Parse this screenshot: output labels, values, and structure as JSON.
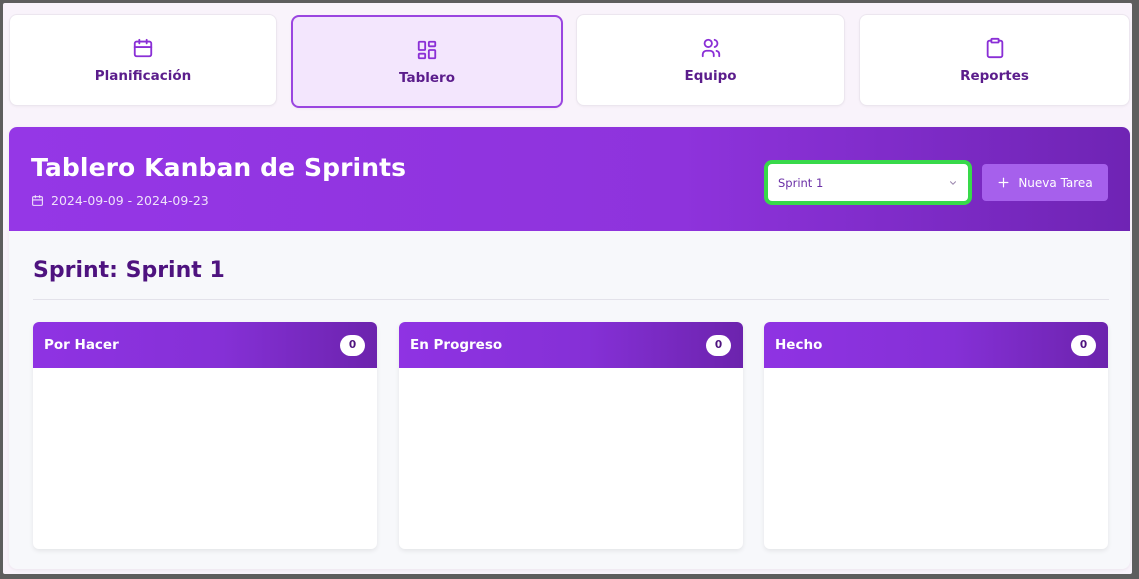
{
  "nav": {
    "items": [
      {
        "label": "Planificación",
        "icon": "calendar-icon",
        "active": false
      },
      {
        "label": "Tablero",
        "icon": "board-icon",
        "active": true
      },
      {
        "label": "Equipo",
        "icon": "users-icon",
        "active": false
      },
      {
        "label": "Reportes",
        "icon": "clipboard-icon",
        "active": false
      }
    ]
  },
  "header": {
    "title": "Tablero Kanban de Sprints",
    "dates": "2024-09-09 - 2024-09-23",
    "sprint_select": {
      "value": "Sprint 1"
    },
    "new_task_label": "Nueva Tarea"
  },
  "board": {
    "heading": "Sprint: Sprint 1",
    "columns": [
      {
        "title": "Por Hacer",
        "count": "0"
      },
      {
        "title": "En Progreso",
        "count": "0"
      },
      {
        "title": "Hecho",
        "count": "0"
      }
    ]
  },
  "colors": {
    "accent": "#8e33dc",
    "text_primary": "#4e137f",
    "select_highlight": "#38d94a",
    "button": "#a660ec"
  }
}
